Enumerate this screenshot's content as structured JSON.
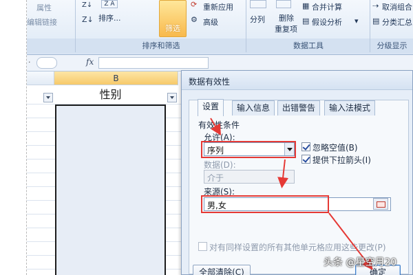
{
  "ribbon": {
    "left_items": [
      "属性",
      "编辑链接"
    ],
    "sort_label": "排序...",
    "filter_label": "筛选",
    "reapply_label": "重新应用",
    "advanced_label": "高级",
    "group_sort_filter": "排序和筛选",
    "split_label": "分列",
    "remove_dup_label": "删除\n重复项",
    "consolidate_label": "合并计算",
    "whatif_label": "假设分析",
    "group_data_tools": "数据工具",
    "ungroup_label": "取消组合",
    "subtotal_label": "分类汇总",
    "group_outline": "分级显示"
  },
  "formula_bar": {
    "fx": "fx"
  },
  "sheet": {
    "column_b_header": "B",
    "header_cell": "性别"
  },
  "dialog": {
    "title": "数据有效性",
    "tabs": [
      "设置",
      "输入信息",
      "出错警告",
      "输入法模式"
    ],
    "criteria_label": "有效性条件",
    "allow_label": "允许(A):",
    "allow_value": "序列",
    "ignore_blank_label": "忽略空值(B)",
    "ignore_blank_checked": true,
    "dropdown_label": "提供下拉箭头(I)",
    "dropdown_checked": true,
    "data_label": "数据(D):",
    "data_value": "介于",
    "source_label": "来源(S):",
    "source_value": "男,女",
    "apply_all_label": "对有同样设置的所有其他单元格应用这些更改(P)",
    "apply_all_checked": false,
    "clear_all_label": "全部清除(C)",
    "ok_label": "确定"
  },
  "watermark": "头条 @星空月20",
  "colors": {
    "annotation_red": "#e53935",
    "filter_orange": "#f8b94d",
    "dialog_bg": "#e6eef8"
  }
}
